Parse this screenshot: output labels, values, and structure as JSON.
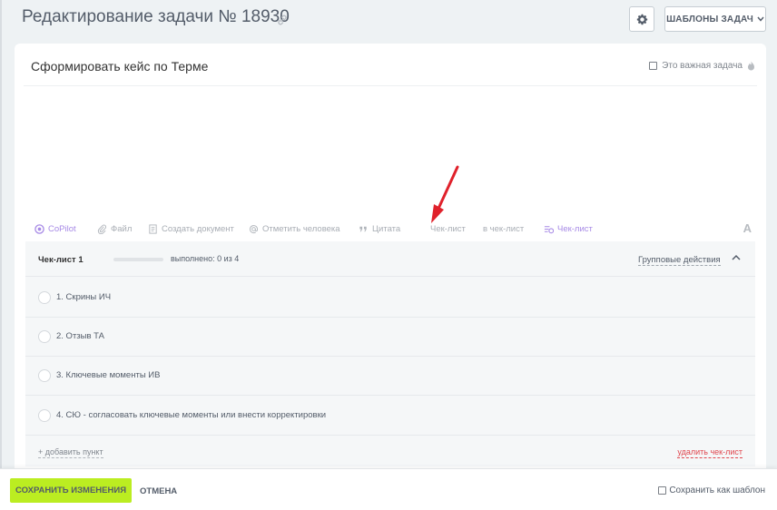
{
  "header": {
    "title": "Редактирование задачи № 18930",
    "templates_label": "ШАБЛОНЫ ЗАДАЧ"
  },
  "task": {
    "title": "Сформировать кейс по Терме",
    "important_label": "Это важная задача"
  },
  "toolbar": {
    "copilot": "CoPilot",
    "file": "Файл",
    "create_doc": "Создать документ",
    "mention": "Отметить человека",
    "quote": "Цитата",
    "checklist": "Чек-лист",
    "to_checklist": "в чек-лист",
    "checklist2": "Чек-лист",
    "font": "A"
  },
  "checklist": {
    "name": "Чек-лист 1",
    "done_text": "выполнено: 0 из 4",
    "progress": 0,
    "group_actions": "Групповые действия",
    "items": [
      {
        "label": "1. Скрины ИЧ"
      },
      {
        "label": "2. Отзыв ТА"
      },
      {
        "label": "3. Ключевые моменты ИВ"
      },
      {
        "label": "4. СЮ - согласовать ключевые моменты или внести корректировки"
      }
    ],
    "add_item": "+ добавить пункт",
    "delete": "удалить чек-лист"
  },
  "footer": {
    "save": "СОХРАНИТЬ ИЗМЕНЕНИЯ",
    "cancel": "ОТМЕНА",
    "save_template": "Сохранить как шаблон"
  },
  "colors": {
    "accent_green": "#bbed21",
    "copilot_purple": "#a78ae6",
    "delete_red": "#e0464e",
    "annotation_red": "#e0212b"
  }
}
